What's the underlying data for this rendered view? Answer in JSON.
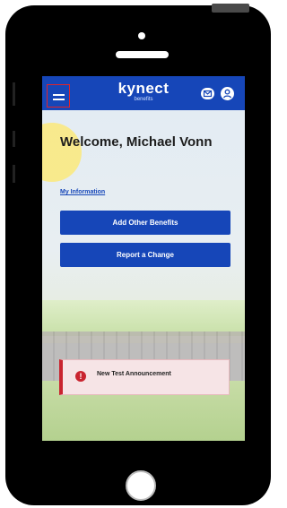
{
  "header": {
    "logo_word": "kynect",
    "logo_sub": "benefits",
    "icons": [
      "hamburger-menu-icon",
      "mail-icon",
      "account-icon"
    ],
    "accent_color": "#1646b8"
  },
  "main": {
    "welcome_text": "Welcome, Michael Vonn",
    "my_information_link": "My Information",
    "add_benefits_label": "Add Other Benefits",
    "report_change_label": "Report a Change"
  },
  "announcement": {
    "icon": "alert-icon",
    "icon_glyph": "!",
    "text": "New Test Announcement",
    "color": "#c9242f"
  }
}
